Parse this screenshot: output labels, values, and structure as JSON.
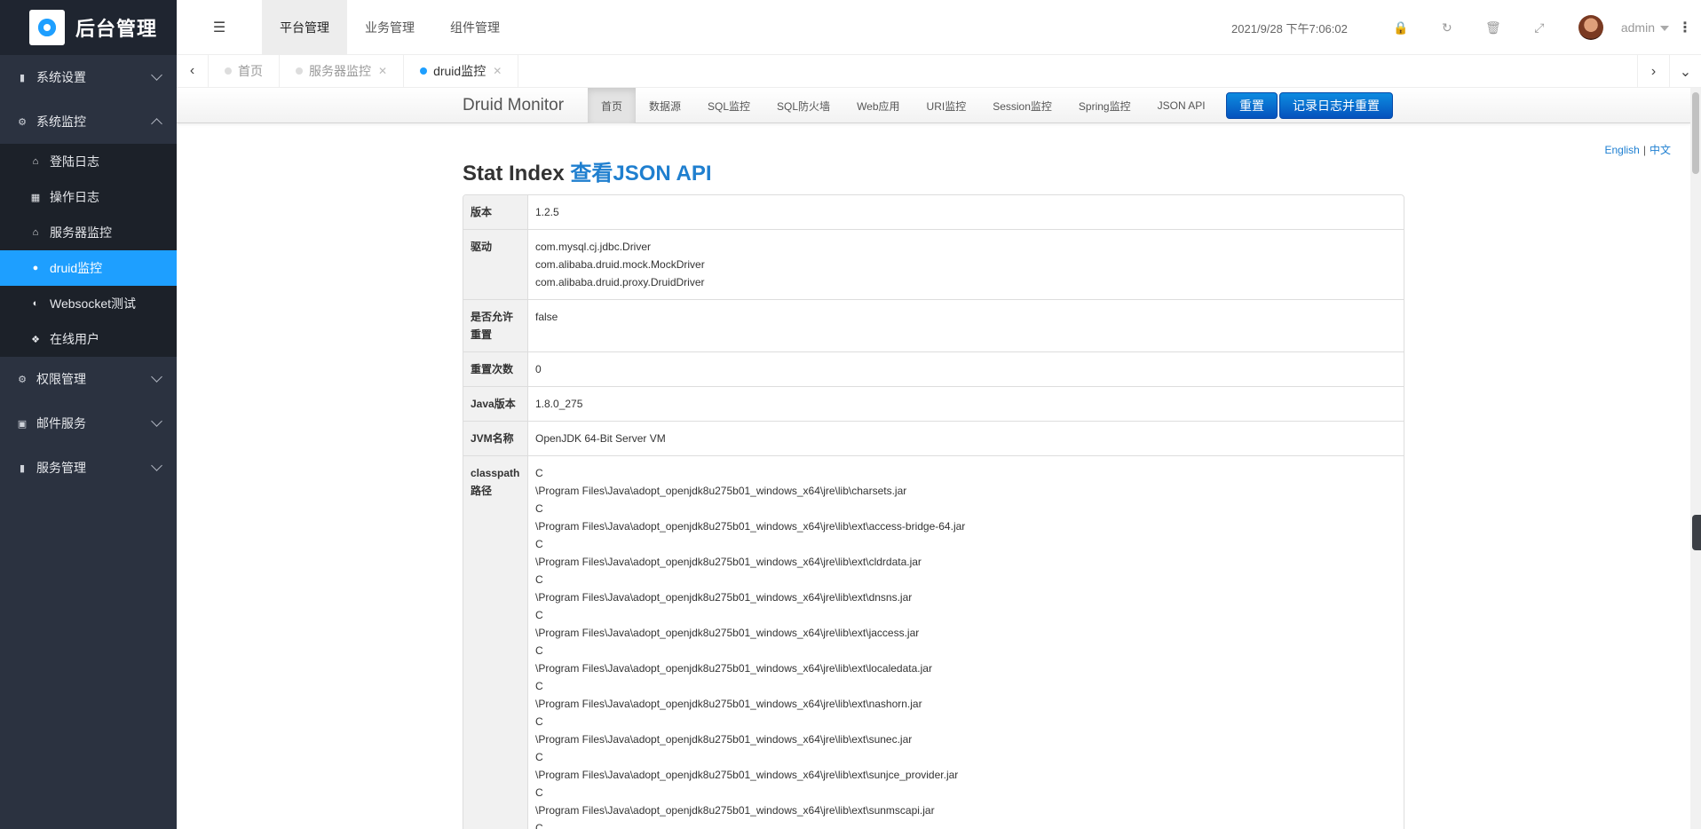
{
  "sidebar": {
    "logo_text": "后台管理",
    "groups": [
      {
        "label": "系统设置",
        "icon": "bookmark-icon",
        "expanded": false
      },
      {
        "label": "系统监控",
        "icon": "gears-icon",
        "expanded": true
      },
      {
        "label": "权限管理",
        "icon": "gears-icon",
        "expanded": false
      },
      {
        "label": "邮件服务",
        "icon": "contact-icon",
        "expanded": false
      },
      {
        "label": "服务管理",
        "icon": "bookmark-icon",
        "expanded": false
      }
    ],
    "monitor_items": [
      {
        "label": "登陆日志",
        "icon": "home-icon"
      },
      {
        "label": "操作日志",
        "icon": "calendar-icon"
      },
      {
        "label": "服务器监控",
        "icon": "home-icon"
      },
      {
        "label": "druid监控",
        "icon": "circle-icon",
        "active": true
      },
      {
        "label": "Websocket测试",
        "icon": "half-circle-icon"
      },
      {
        "label": "在线用户",
        "icon": "codepen-icon"
      }
    ]
  },
  "topbar": {
    "tabs": [
      "平台管理",
      "业务管理",
      "组件管理"
    ],
    "active_tab": "平台管理",
    "datetime": "2021/9/28 下午7:06:02",
    "user": "admin"
  },
  "page_tabs": [
    {
      "label": "首页",
      "closable": false
    },
    {
      "label": "服务器监控",
      "closable": true
    },
    {
      "label": "druid监控",
      "closable": true,
      "active": true
    }
  ],
  "druid": {
    "brand": "Druid Monitor",
    "nav": [
      "首页",
      "数据源",
      "SQL监控",
      "SQL防火墙",
      "Web应用",
      "URI监控",
      "Session监控",
      "Spring监控",
      "JSON API"
    ],
    "reset_btn": "重置",
    "log_reset_btn": "记录日志并重置",
    "lang_en": "English",
    "lang_sep": "|",
    "lang_zh": "中文",
    "title": "Stat Index",
    "title_link": "查看JSON API",
    "rows": [
      {
        "key": "版本",
        "lines": [
          "1.2.5"
        ]
      },
      {
        "key": "驱动",
        "lines": [
          "com.mysql.cj.jdbc.Driver",
          "com.alibaba.druid.mock.MockDriver",
          "com.alibaba.druid.proxy.DruidDriver"
        ]
      },
      {
        "key": "是否允许重置",
        "lines": [
          "false"
        ]
      },
      {
        "key": "重置次数",
        "lines": [
          "0"
        ]
      },
      {
        "key": "Java版本",
        "lines": [
          "1.8.0_275"
        ]
      },
      {
        "key": "JVM名称",
        "lines": [
          "OpenJDK 64-Bit Server VM"
        ]
      },
      {
        "key": "classpath路径",
        "lines": [
          "C",
          "\\Program Files\\Java\\adopt_openjdk8u275b01_windows_x64\\jre\\lib\\charsets.jar",
          "C",
          "\\Program Files\\Java\\adopt_openjdk8u275b01_windows_x64\\jre\\lib\\ext\\access-bridge-64.jar",
          "C",
          "\\Program Files\\Java\\adopt_openjdk8u275b01_windows_x64\\jre\\lib\\ext\\cldrdata.jar",
          "C",
          "\\Program Files\\Java\\adopt_openjdk8u275b01_windows_x64\\jre\\lib\\ext\\dnsns.jar",
          "C",
          "\\Program Files\\Java\\adopt_openjdk8u275b01_windows_x64\\jre\\lib\\ext\\jaccess.jar",
          "C",
          "\\Program Files\\Java\\adopt_openjdk8u275b01_windows_x64\\jre\\lib\\ext\\localedata.jar",
          "C",
          "\\Program Files\\Java\\adopt_openjdk8u275b01_windows_x64\\jre\\lib\\ext\\nashorn.jar",
          "C",
          "\\Program Files\\Java\\adopt_openjdk8u275b01_windows_x64\\jre\\lib\\ext\\sunec.jar",
          "C",
          "\\Program Files\\Java\\adopt_openjdk8u275b01_windows_x64\\jre\\lib\\ext\\sunjce_provider.jar",
          "C",
          "\\Program Files\\Java\\adopt_openjdk8u275b01_windows_x64\\jre\\lib\\ext\\sunmscapi.jar",
          "C"
        ]
      }
    ]
  },
  "colors": {
    "accent": "#1e9fff",
    "sidebar_bg": "#2b3240",
    "button_blue": "#0d8be0",
    "link_blue": "#1f7fcf"
  }
}
